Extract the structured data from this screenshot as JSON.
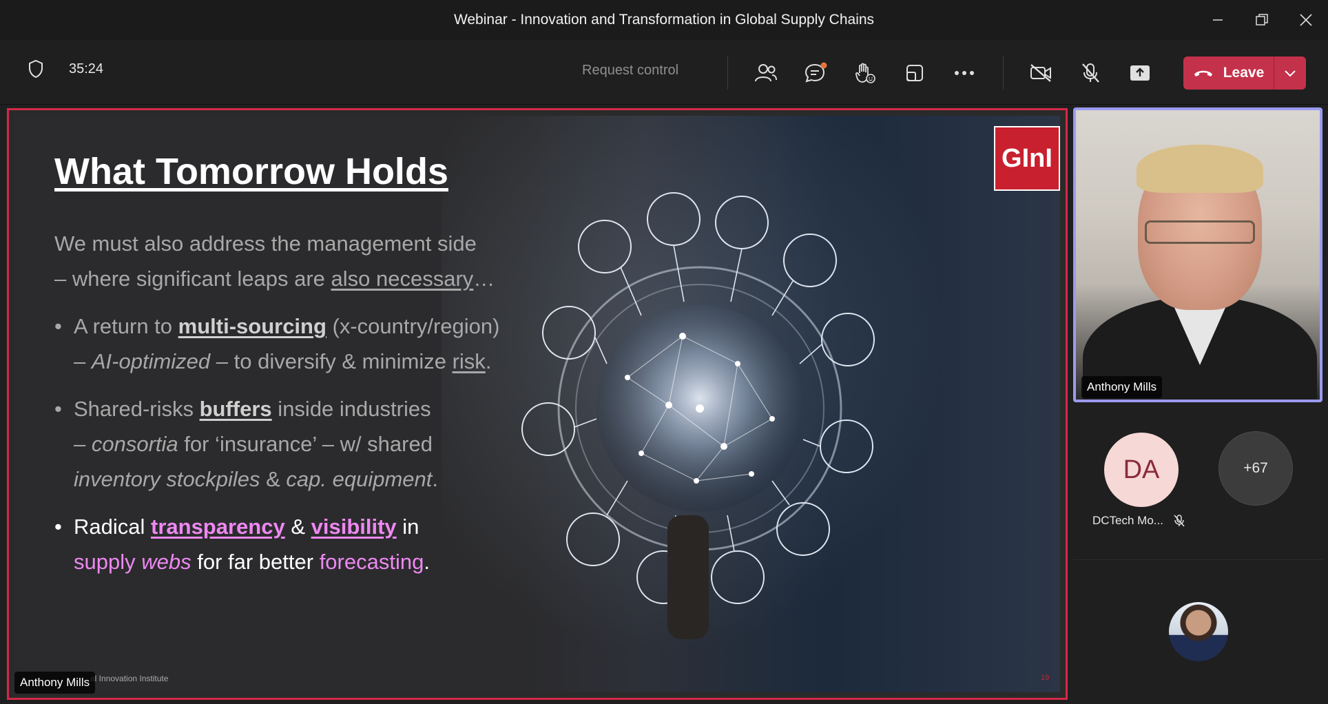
{
  "window": {
    "title": "Webinar - Innovation and Transformation in Global Supply Chains"
  },
  "toolbar": {
    "timer": "35:24",
    "request_control": "Request control",
    "leave_label": "Leave",
    "icons": [
      "shield-icon",
      "people-icon",
      "chat-icon",
      "raise-hand-icon",
      "share-tray-icon",
      "more-icon",
      "camera-off-icon",
      "mic-off-icon",
      "share-icon",
      "phone-icon",
      "chevron-down-icon"
    ],
    "leave_color": "#c4314b"
  },
  "slide": {
    "heading": "What Tomorrow Holds",
    "intro_1": "We must also address the management side",
    "intro_2a": "– where significant leaps are ",
    "intro_2b": "also necessary",
    "intro_2c": "…",
    "b1_1a": "A return to ",
    "b1_1b": "multi-sourcing",
    "b1_1c": " (x-country/region)",
    "b1_2a": "– ",
    "b1_2b": "AI-optimized",
    "b1_2c": " – to diversify & minimize ",
    "b1_2d": "risk",
    "b1_2e": ".",
    "b2_1a": "Shared-risks ",
    "b2_1b": "buffers",
    "b2_1c": " inside industries",
    "b2_2a": "– ",
    "b2_2b": "consortia",
    "b2_2c": " for ‘insurance’ – w/ shared",
    "b2_3a": "inventory stockpiles",
    "b2_3b": " & ",
    "b2_3c": "cap. equipment",
    "b2_3d": ".",
    "b3_1a": "Radical ",
    "b3_1b": "transparency",
    "b3_1c": " & ",
    "b3_1d": "visibility",
    "b3_1e": " in",
    "b3_2a": "supply ",
    "b3_2b": "webs",
    "b3_2c": " for far better ",
    "b3_2d": "forecasting",
    "b3_2e": ".",
    "logo": "GInI",
    "footer": "al Innovation Institute",
    "page_number": "19",
    "presenter_tag": "Anthony Mills",
    "accent_color": "#ee88f2",
    "stage_border_color": "#d4294a"
  },
  "panel": {
    "main_video_name": "Anthony Mills",
    "participant_1_initials": "DA",
    "participant_1_name": "DCTech Mo...",
    "overflow_count": "+67"
  }
}
